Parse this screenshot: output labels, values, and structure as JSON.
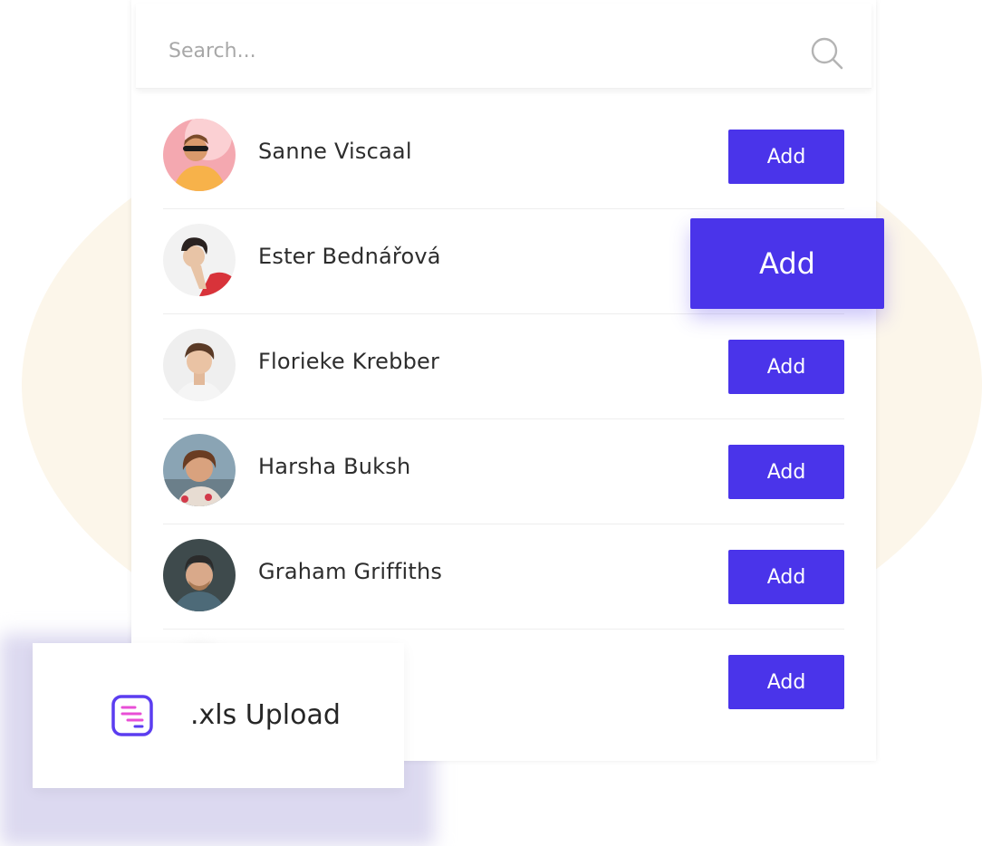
{
  "search": {
    "placeholder": "Search..."
  },
  "contacts": [
    {
      "name": "Sanne Viscaal",
      "button": "Add"
    },
    {
      "name": "Ester Bednářová",
      "button": "Add"
    },
    {
      "name": "Florieke Krebber",
      "button": "Add"
    },
    {
      "name": "Harsha Buksh",
      "button": "Add"
    },
    {
      "name": "Graham Griffiths",
      "button": "Add"
    },
    {
      "name": "",
      "button": "Add"
    }
  ],
  "upload": {
    "label": ".xls Upload",
    "icon": "spreadsheet-icon"
  },
  "colors": {
    "accent": "#4a34ea",
    "background_circle": "#fcf6ea",
    "upload_icon_stroke": "#5b3df0",
    "upload_icon_lines": "#e84fd6"
  }
}
